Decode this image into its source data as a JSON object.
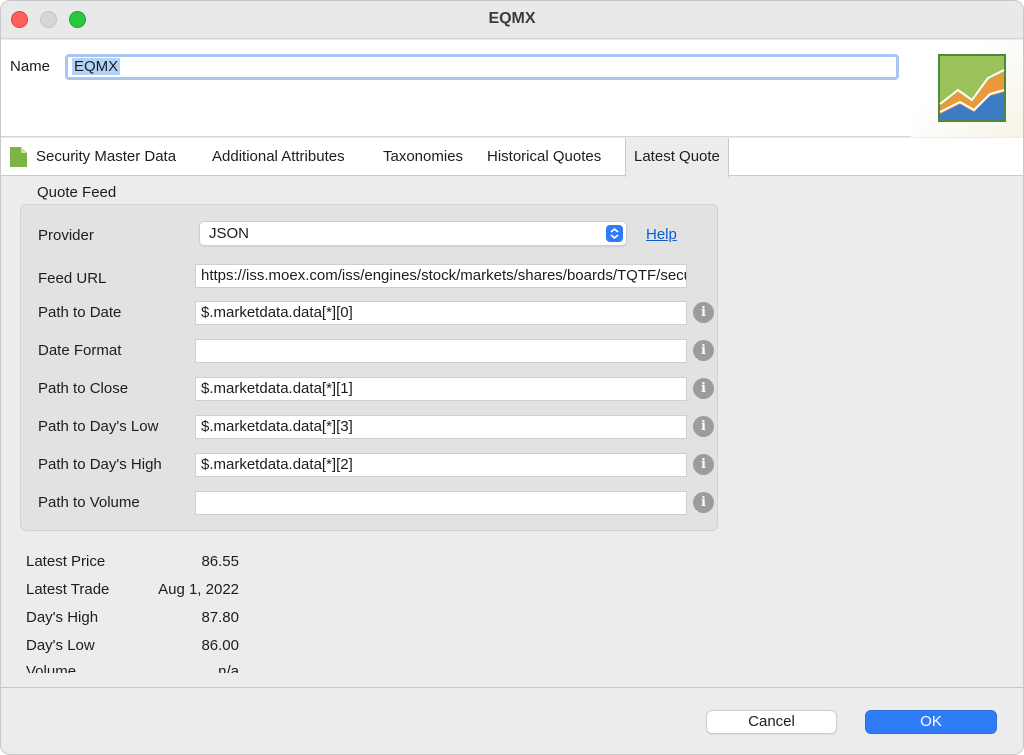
{
  "window": {
    "title": "EQMX"
  },
  "header": {
    "name_label": "Name",
    "name_value": "EQMX"
  },
  "tabs": [
    {
      "label": "Security Master Data"
    },
    {
      "label": "Additional Attributes"
    },
    {
      "label": "Taxonomies"
    },
    {
      "label": "Historical Quotes"
    },
    {
      "label": "Latest Quote",
      "active": true
    }
  ],
  "quote_feed": {
    "section_title": "Quote Feed",
    "provider_label": "Provider",
    "provider_value": "JSON",
    "help_label": "Help",
    "fields": [
      {
        "label": "Feed URL",
        "value": "https://iss.moex.com/iss/engines/stock/markets/shares/boards/TQTF/securities/EQMX.json"
      },
      {
        "label": "Path to Date",
        "value": "$.marketdata.data[*][0]"
      },
      {
        "label": "Date Format",
        "value": ""
      },
      {
        "label": "Path to Close",
        "value": "$.marketdata.data[*][1]"
      },
      {
        "label": "Path to Day's Low",
        "value": "$.marketdata.data[*][3]"
      },
      {
        "label": "Path to Day's High",
        "value": "$.marketdata.data[*][2]"
      },
      {
        "label": "Path to Volume",
        "value": ""
      }
    ],
    "info_glyph": "i"
  },
  "summary": [
    {
      "label": "Latest Price",
      "value": "86.55"
    },
    {
      "label": "Latest Trade",
      "value": "Aug 1, 2022"
    },
    {
      "label": "Day's High",
      "value": "87.80"
    },
    {
      "label": "Day's Low",
      "value": "86.00"
    },
    {
      "label": "Volume",
      "value": "n/a"
    }
  ],
  "footer": {
    "cancel_label": "Cancel",
    "ok_label": "OK"
  },
  "colors": {
    "accent": "#2f7cf6",
    "link": "#0a5ccf",
    "close": "#fe5f57",
    "zoom": "#28c840"
  },
  "icons": [
    "document-icon",
    "chart-logo-icon",
    "info-icon",
    "chevron-updown-icon"
  ]
}
